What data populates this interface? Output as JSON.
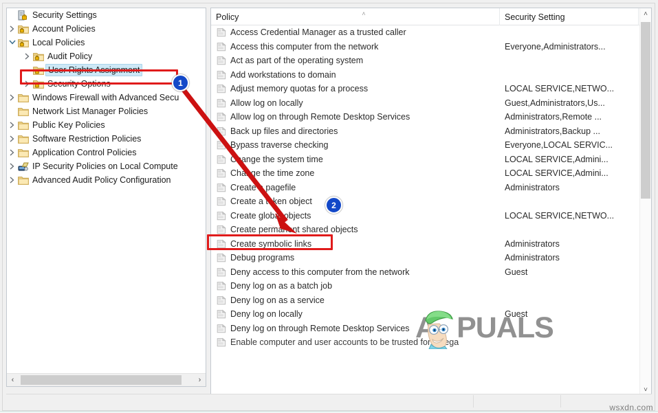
{
  "window": {
    "left_pane_name": "console-tree",
    "right_pane_name": "policy-list"
  },
  "tree": {
    "root": {
      "label": "Security Settings",
      "icon": "security-settings-icon",
      "indent": 0,
      "twisty": "none",
      "selected": false
    },
    "items": [
      {
        "label": "Security Settings",
        "icon": "security-settings-icon",
        "indent": 0,
        "twisty": "none",
        "selected": false
      },
      {
        "label": "Account Policies",
        "icon": "policy-folder-icon",
        "indent": 1,
        "twisty": "collapsed",
        "selected": false
      },
      {
        "label": "Local Policies",
        "icon": "policy-folder-icon",
        "indent": 1,
        "twisty": "expanded",
        "selected": false
      },
      {
        "label": "Audit Policy",
        "icon": "policy-folder-icon",
        "indent": 2,
        "twisty": "collapsed",
        "selected": false
      },
      {
        "label": "User Rights Assignment",
        "icon": "policy-folder-icon",
        "indent": 2,
        "twisty": "none",
        "selected": true
      },
      {
        "label": "Security Options",
        "icon": "policy-folder-icon",
        "indent": 2,
        "twisty": "collapsed",
        "selected": false
      },
      {
        "label": "Windows Firewall with Advanced Secu",
        "icon": "folder-icon",
        "indent": 1,
        "twisty": "collapsed",
        "selected": false
      },
      {
        "label": "Network List Manager Policies",
        "icon": "folder-icon",
        "indent": 1,
        "twisty": "none",
        "selected": false
      },
      {
        "label": "Public Key Policies",
        "icon": "folder-icon",
        "indent": 1,
        "twisty": "collapsed",
        "selected": false
      },
      {
        "label": "Software Restriction Policies",
        "icon": "folder-icon",
        "indent": 1,
        "twisty": "collapsed",
        "selected": false
      },
      {
        "label": "Application Control Policies",
        "icon": "folder-icon",
        "indent": 1,
        "twisty": "collapsed",
        "selected": false
      },
      {
        "label": "IP Security Policies on Local Compute",
        "icon": "ip-security-icon",
        "indent": 1,
        "twisty": "collapsed",
        "selected": false
      },
      {
        "label": "Advanced Audit Policy Configuration",
        "icon": "folder-icon",
        "indent": 1,
        "twisty": "collapsed",
        "selected": false
      }
    ],
    "hscroll": {
      "left_arrow": "‹",
      "right_arrow": "›"
    }
  },
  "list": {
    "columns": [
      {
        "key": "policy",
        "label": "Policy",
        "sorted": "ascending"
      },
      {
        "key": "setting",
        "label": "Security Setting",
        "sorted": "none"
      }
    ],
    "sort_caret": "˄",
    "row_icon": "policy-item-icon",
    "rows": [
      {
        "policy": "Access Credential Manager as a trusted caller",
        "setting": ""
      },
      {
        "policy": "Access this computer from the network",
        "setting": "Everyone,Administrators..."
      },
      {
        "policy": "Act as part of the operating system",
        "setting": ""
      },
      {
        "policy": "Add workstations to domain",
        "setting": ""
      },
      {
        "policy": "Adjust memory quotas for a process",
        "setting": "LOCAL SERVICE,NETWO..."
      },
      {
        "policy": "Allow log on locally",
        "setting": "Guest,Administrators,Us..."
      },
      {
        "policy": "Allow log on through Remote Desktop Services",
        "setting": "Administrators,Remote ..."
      },
      {
        "policy": "Back up files and directories",
        "setting": "Administrators,Backup ..."
      },
      {
        "policy": "Bypass traverse checking",
        "setting": "Everyone,LOCAL SERVIC..."
      },
      {
        "policy": "Change the system time",
        "setting": "LOCAL SERVICE,Admini..."
      },
      {
        "policy": "Change the time zone",
        "setting": "LOCAL SERVICE,Admini..."
      },
      {
        "policy": "Create a pagefile",
        "setting": "Administrators"
      },
      {
        "policy": "Create a token object",
        "setting": ""
      },
      {
        "policy": "Create global objects",
        "setting": "LOCAL SERVICE,NETWO..."
      },
      {
        "policy": "Create permanent shared objects",
        "setting": ""
      },
      {
        "policy": "Create symbolic links",
        "setting": "Administrators"
      },
      {
        "policy": "Debug programs",
        "setting": "Administrators"
      },
      {
        "policy": "Deny access to this computer from the network",
        "setting": "Guest"
      },
      {
        "policy": "Deny log on as a batch job",
        "setting": ""
      },
      {
        "policy": "Deny log on as a service",
        "setting": ""
      },
      {
        "policy": "Deny log on locally",
        "setting": "Guest"
      },
      {
        "policy": "Deny log on through Remote Desktop Services",
        "setting": ""
      },
      {
        "policy": "Enable computer and user accounts to be trusted for delega",
        "setting": ""
      }
    ],
    "vscroll": {
      "up_arrow": "˄",
      "down_arrow": "˅"
    }
  },
  "annotations": {
    "badges": [
      {
        "number": "1",
        "target": "User Rights Assignment"
      },
      {
        "number": "2",
        "target": "Create a token object"
      }
    ],
    "highlight_color": "#e01b1b",
    "badge_color": "#1348c8",
    "arrow_color": "#cc1111",
    "highlights": [
      {
        "target": "User Rights Assignment"
      },
      {
        "target": "Create a token object"
      }
    ]
  },
  "watermarks": {
    "brand_a": "A",
    "brand_rest": "PPUALS",
    "brand_tail": "PUALS",
    "site": "wsxdn.com"
  }
}
